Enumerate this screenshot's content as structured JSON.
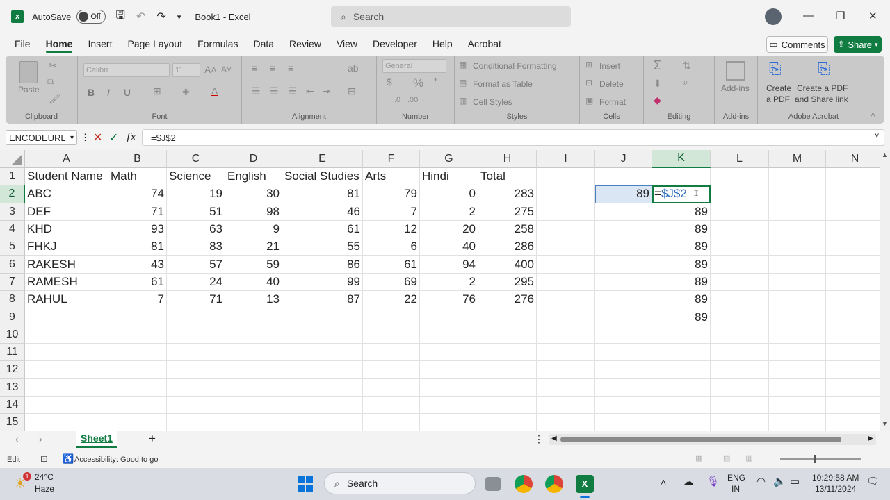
{
  "app": {
    "autosave_label": "AutoSave",
    "autosave_state": "Off",
    "doc_title": "Book1  -  Excel",
    "search_placeholder": "Search",
    "accent": "#107c41"
  },
  "tabs": [
    "File",
    "Home",
    "Insert",
    "Page Layout",
    "Formulas",
    "Data",
    "Review",
    "View",
    "Developer",
    "Help",
    "Acrobat"
  ],
  "actions": {
    "comments": "Comments",
    "share": "Share"
  },
  "ribbon": {
    "clipboard": {
      "paste": "Paste",
      "label": "Clipboard"
    },
    "font": {
      "name": "Calibri",
      "size": "11",
      "bold": "B",
      "italic": "I",
      "underline": "U",
      "label": "Font"
    },
    "alignment": {
      "label": "Alignment"
    },
    "number": {
      "format": "General",
      "label": "Number"
    },
    "styles": {
      "conditional": "Conditional Formatting",
      "format_table": "Format as Table",
      "cell_styles": "Cell Styles",
      "label": "Styles"
    },
    "cells": {
      "insert": "Insert",
      "delete": "Delete",
      "format": "Format",
      "label": "Cells"
    },
    "editing": {
      "label": "Editing"
    },
    "addins": {
      "addins": "Add-ins",
      "label": "Add-ins"
    },
    "acrobat": {
      "create_pdf_1": "Create",
      "create_pdf_2": "a PDF",
      "share_1": "Create a PDF",
      "share_2": "and Share link",
      "label": "Adobe Acrobat"
    }
  },
  "formula_bar": {
    "name_box": "ENCODEURL",
    "fx": "fx",
    "formula": "=$J$2"
  },
  "grid": {
    "columns": [
      "A",
      "B",
      "C",
      "D",
      "E",
      "F",
      "G",
      "H",
      "I",
      "J",
      "K",
      "L",
      "M",
      "N"
    ],
    "rows": [
      "1",
      "2",
      "3",
      "4",
      "5",
      "6",
      "7",
      "8",
      "9",
      "10",
      "11",
      "12",
      "13",
      "14",
      "15"
    ],
    "header_row": [
      "Student Name",
      "Math",
      "Science",
      "English",
      "Social Studies",
      "Arts",
      "Hindi",
      "Total"
    ],
    "students": [
      {
        "name": "ABC",
        "scores": [
          "74",
          "19",
          "30",
          "81",
          "79",
          "0",
          "283"
        ]
      },
      {
        "name": "DEF",
        "scores": [
          "71",
          "51",
          "98",
          "46",
          "7",
          "2",
          "275"
        ]
      },
      {
        "name": "KHD",
        "scores": [
          "93",
          "63",
          "9",
          "61",
          "12",
          "20",
          "258"
        ]
      },
      {
        "name": "FHKJ",
        "scores": [
          "81",
          "83",
          "21",
          "55",
          "6",
          "40",
          "286"
        ]
      },
      {
        "name": "RAKESH",
        "scores": [
          "43",
          "57",
          "59",
          "86",
          "61",
          "94",
          "400"
        ]
      },
      {
        "name": "RAMESH",
        "scores": [
          "61",
          "24",
          "40",
          "99",
          "69",
          "2",
          "295"
        ]
      },
      {
        "name": "RAHUL",
        "scores": [
          "7",
          "71",
          "13",
          "87",
          "22",
          "76",
          "276"
        ]
      }
    ],
    "j2": "89",
    "k2_prefix": "=",
    "k2_ref": "$J$2",
    "k_values": [
      "89",
      "89",
      "89",
      "89",
      "89",
      "89",
      "89"
    ]
  },
  "sheets": {
    "active": "Sheet1",
    "add": "+"
  },
  "status": {
    "mode": "Edit",
    "accessibility": "Accessibility: Good to go"
  },
  "taskbar": {
    "weather_temp": "24°C",
    "weather_desc": "Haze",
    "weather_badge": "1",
    "search": "Search",
    "lang_1": "ENG",
    "lang_2": "IN",
    "time": "10:29:58 AM",
    "date": "13/11/2024"
  }
}
